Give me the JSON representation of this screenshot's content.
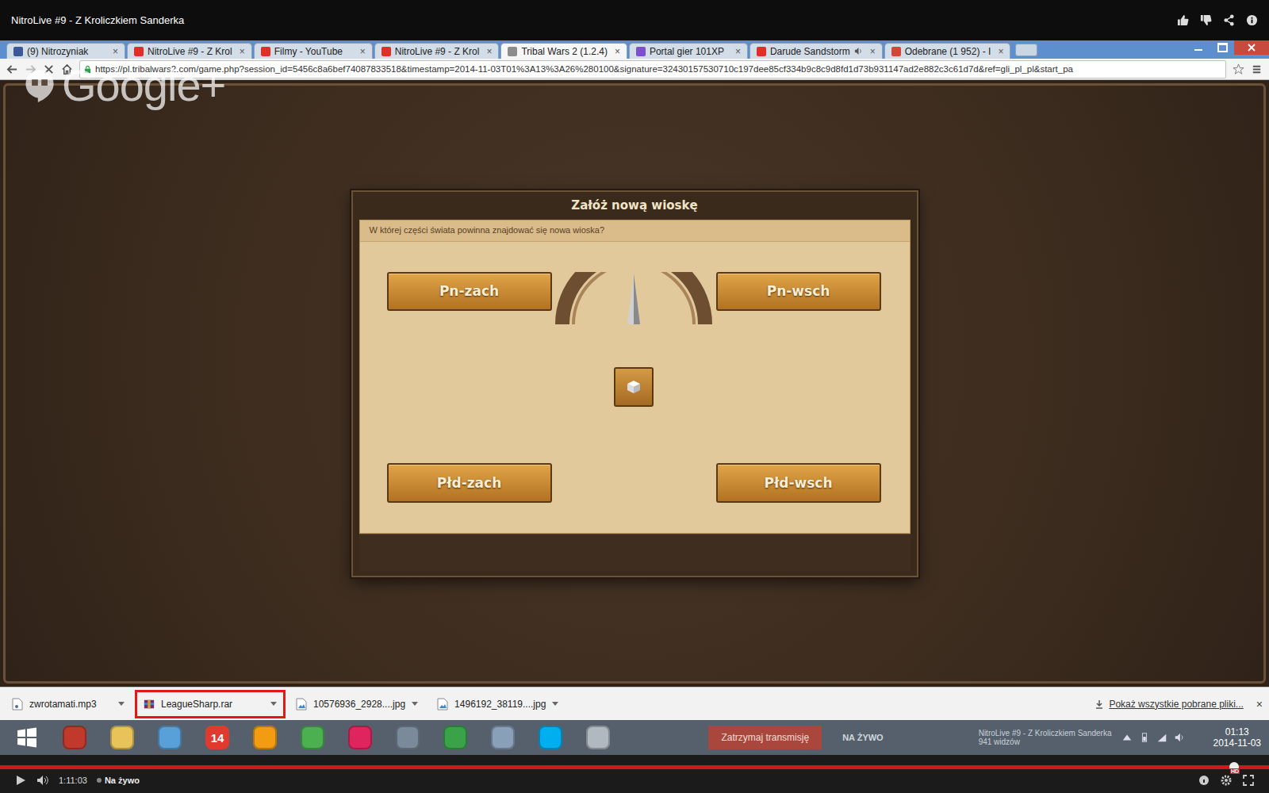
{
  "player": {
    "title": "NitroLive #9 - Z Kroliczkiem Sanderka",
    "time": "1:11:03",
    "live": "Na żywo",
    "hd": "HD",
    "progress": {
      "level": 1
    }
  },
  "browser": {
    "tabs": [
      {
        "label": "(9) Nitrozyniak",
        "selected": false,
        "audio": false,
        "color": "#3b5998"
      },
      {
        "label": "NitroLive #9 - Z Krol",
        "selected": false,
        "audio": false,
        "color": "#e52d27"
      },
      {
        "label": "Filmy - YouTube",
        "selected": false,
        "audio": false,
        "color": "#e52d27"
      },
      {
        "label": "NitroLive #9 - Z Krol",
        "selected": false,
        "audio": false,
        "color": "#e52d27"
      },
      {
        "label": "Tribal Wars 2 (1.2.4)",
        "selected": true,
        "audio": false,
        "color": "#8c8c8c"
      },
      {
        "label": "Portal gier 101XP",
        "selected": false,
        "audio": false,
        "color": "#7b4fd0"
      },
      {
        "label": "Darude Sandstorm",
        "selected": false,
        "audio": true,
        "color": "#e52d27"
      },
      {
        "label": "Odebrane (1 952) - I",
        "selected": false,
        "audio": false,
        "color": "#d44638"
      }
    ],
    "close": "×",
    "url": "https://pl.tribalwars2.com/game.php?session_id=5456c8a6bef74087833518&timestamp=2014-11-03T01%3A13%3A26%280100&signature=32430157530710c197dee85cf334b9c8c9d8fd1d73b931147ad2e882c3c61d7d&ref=gli_pl_pl&start_pa"
  },
  "watermark": "Google+",
  "dialog": {
    "title": "Załóż nową wioskę",
    "prompt": "W której części świata powinna znajdować się nowa wioska?",
    "buttons": [
      {
        "label": "Pn-zach"
      },
      {
        "label": "Pn-wsch"
      },
      {
        "label": "Płd-zach"
      },
      {
        "label": "Płd-wsch"
      }
    ]
  },
  "downloads": {
    "items": [
      {
        "name": "zwrotamati.mp3",
        "kind": "audio",
        "highlighted": false
      },
      {
        "name": "LeagueSharp.rar",
        "kind": "archive",
        "highlighted": true
      },
      {
        "name": "10576936_2928....jpg",
        "kind": "image",
        "highlighted": false
      },
      {
        "name": "1496192_38119....jpg",
        "kind": "image",
        "highlighted": false
      }
    ],
    "show_all": "Pokaż wszystkie pobrane pliki...",
    "close": "×"
  },
  "taskbar": {
    "apps": [
      {
        "kind": "windows",
        "color": "#ffffff"
      },
      {
        "kind": "tile",
        "color": "#c0392b"
      },
      {
        "kind": "tile",
        "color": "#e8c35a"
      },
      {
        "kind": "tile",
        "color": "#5aa0d8"
      },
      {
        "kind": "badge",
        "color": "#e03a2f",
        "label": "14"
      },
      {
        "kind": "tile",
        "color": "#f39c12"
      },
      {
        "kind": "tile",
        "color": "#4caf50"
      },
      {
        "kind": "tile",
        "color": "#e0245e"
      },
      {
        "kind": "tile",
        "color": "#7a8a9a"
      },
      {
        "kind": "tile",
        "color": "#3aa34a"
      },
      {
        "kind": "tile",
        "color": "#8aa0b8"
      },
      {
        "kind": "tile",
        "color": "#00aff0"
      },
      {
        "kind": "tile",
        "color": "#b0b8c0"
      }
    ],
    "stop_button": "Zatrzymaj transmisję",
    "live": "NA ŻYWO",
    "stream_title": "NitroLive #9 - Z Kroliczkiem Sanderka",
    "viewers": "941 widzów",
    "time": "01:13",
    "date": "2014-11-03"
  }
}
